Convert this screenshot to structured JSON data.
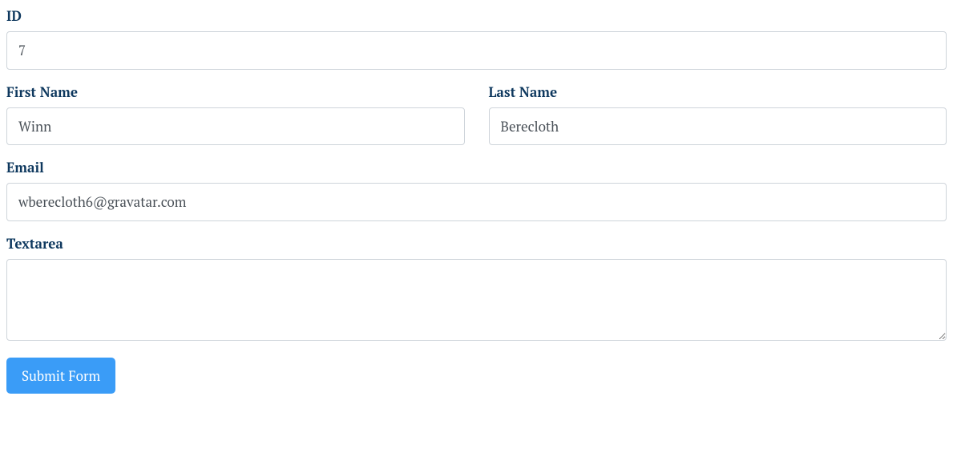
{
  "form": {
    "id": {
      "label": "ID",
      "value": "7"
    },
    "first_name": {
      "label": "First Name",
      "value": "Winn"
    },
    "last_name": {
      "label": "Last Name",
      "value": "Berecloth"
    },
    "email": {
      "label": "Email",
      "value": "wberecloth6@gravatar.com"
    },
    "textarea": {
      "label": "Textarea",
      "value": ""
    },
    "submit_label": "Submit Form"
  }
}
